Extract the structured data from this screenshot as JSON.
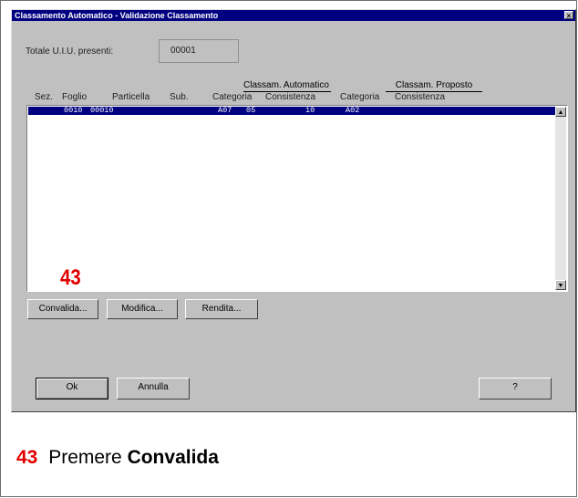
{
  "window": {
    "title": "Classamento Automatico - Validazione Classamento",
    "close_glyph": "×"
  },
  "totale": {
    "label": "Totale U.I.U. presenti:",
    "value": "00001"
  },
  "groups": {
    "automatico": "Classam. Automatico",
    "proposto": "Classam. Proposto"
  },
  "columns": [
    "Sez.",
    "Foglio",
    "Particella",
    "Sub.",
    "Categoria",
    "Consistenza",
    "Categoria",
    "Consistenza"
  ],
  "rows": [
    {
      "sez": "",
      "foglio": "0010",
      "particella": "00010",
      "sub": "",
      "categoria_auto": "A07",
      "consistenza_auto": "05",
      "extra": "10",
      "categoria_prop": "A02",
      "consistenza_prop": ""
    }
  ],
  "scrollbar": {
    "up": "▲",
    "down": "▼"
  },
  "buttons": {
    "convalida": "Convalida...",
    "modifica": "Modifica...",
    "rendita": "Rendita...",
    "ok": "Ok",
    "annulla": "Annulla",
    "help": "?"
  },
  "step": {
    "number": "43",
    "text_prefix": "Premere ",
    "text_action": "Convalida"
  },
  "colors": {
    "titlebar": "#000080",
    "dialog_bg": "#c0c0c0",
    "selection": "#000080",
    "step_marker": "#e00000"
  }
}
